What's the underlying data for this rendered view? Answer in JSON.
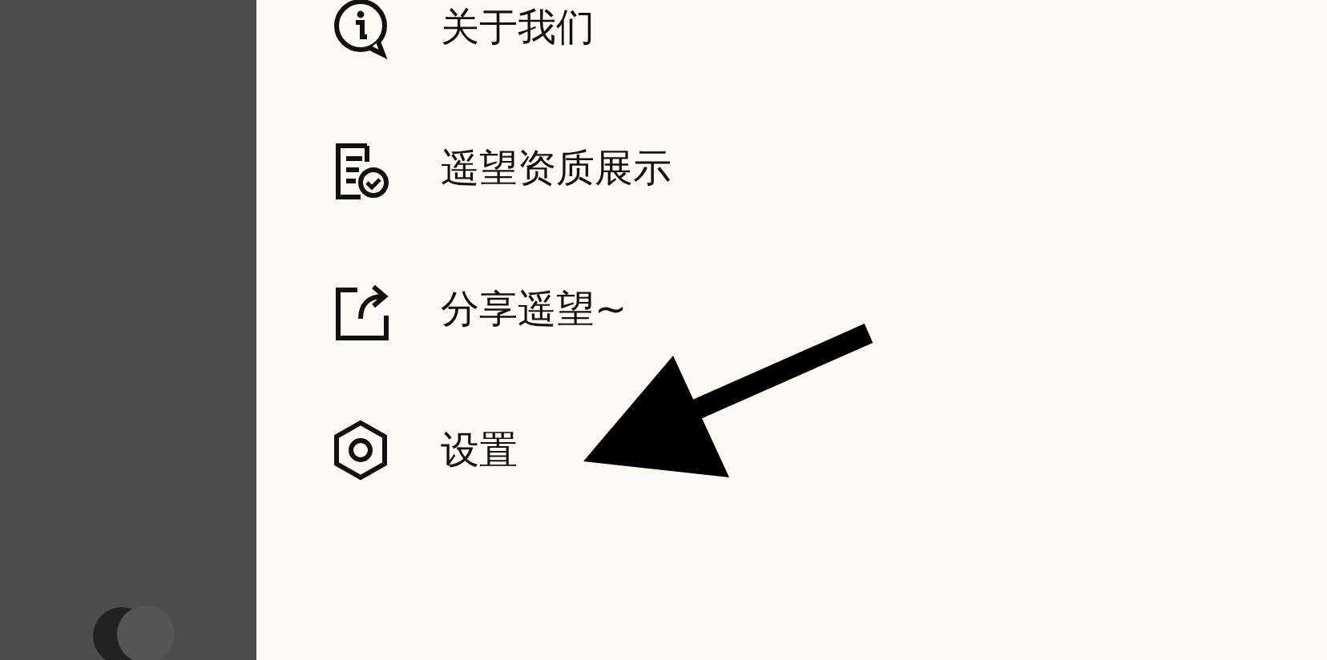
{
  "drawer": {
    "items": [
      {
        "kind": "info",
        "label": "关于我们"
      },
      {
        "kind": "certificate",
        "label": "遥望资质展示"
      },
      {
        "kind": "share",
        "label": "分享遥望~"
      },
      {
        "kind": "settings",
        "label": "设置"
      }
    ]
  }
}
